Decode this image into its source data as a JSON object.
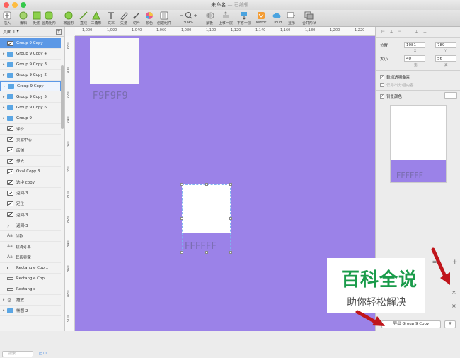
{
  "window": {
    "title": "未命名",
    "subtitle": "— 已编辑"
  },
  "toolbar": [
    {
      "label": "插入",
      "icon": "plus-icon"
    },
    {
      "label": "编辑",
      "icon": "edit-icon"
    },
    {
      "label": "矩形",
      "icon": "rectangle-icon"
    },
    {
      "label": "圆角矩形",
      "icon": "rounded-rect-icon"
    },
    {
      "label": "椭圆形",
      "icon": "oval-icon"
    },
    {
      "label": "直线",
      "icon": "line-icon"
    },
    {
      "label": "三角形",
      "icon": "triangle-icon"
    },
    {
      "label": "文本",
      "icon": "text-icon"
    },
    {
      "label": "矢量",
      "icon": "vector-icon"
    },
    {
      "label": "切片",
      "icon": "slice-icon"
    },
    {
      "label": "颜色",
      "icon": "color-icon"
    },
    {
      "label": "创建组件",
      "icon": "component-icon"
    },
    {
      "label": "309%",
      "icon": "zoom-icon"
    },
    {
      "label": "蒙板",
      "icon": "mask-icon"
    },
    {
      "label": "上移一层",
      "icon": "forward-icon"
    },
    {
      "label": "下移一层",
      "icon": "backward-icon"
    },
    {
      "label": "Mirror",
      "icon": "mirror-icon"
    },
    {
      "label": "Cloud",
      "icon": "cloud-icon"
    },
    {
      "label": "显示",
      "icon": "view-icon"
    },
    {
      "label": "合并形状",
      "icon": "export-icon"
    }
  ],
  "sidebar": {
    "page": "页面 1",
    "search_placeholder": "搜索",
    "layer_count": "10",
    "layers": [
      {
        "name": "Group 9 Copy",
        "type": "symbol",
        "state": "selected"
      },
      {
        "name": "Group 9 Copy 4",
        "type": "folder"
      },
      {
        "name": "Group 9 Copy 3",
        "type": "folder"
      },
      {
        "name": "Group 9 Copy 2",
        "type": "folder"
      },
      {
        "name": "Group 9 Copy",
        "type": "folder",
        "state": "highlight"
      },
      {
        "name": "Group 9 Copy 5",
        "type": "folder"
      },
      {
        "name": "Group 9 Copy 6",
        "type": "folder"
      },
      {
        "name": "Group 9",
        "type": "folder"
      },
      {
        "name": "评价",
        "type": "symbol"
      },
      {
        "name": "卖家中心",
        "type": "symbol"
      },
      {
        "name": "店铺",
        "type": "symbol"
      },
      {
        "name": "想去",
        "type": "symbol"
      },
      {
        "name": "Oval Copy 3",
        "type": "symbol"
      },
      {
        "name": "选中 copy",
        "type": "symbol"
      },
      {
        "name": "返回-3",
        "type": "symbol"
      },
      {
        "name": "定位",
        "type": "symbol"
      },
      {
        "name": "返回-3",
        "type": "symbol"
      },
      {
        "name": "返回-3",
        "type": "chevron"
      },
      {
        "name": "付款",
        "type": "text"
      },
      {
        "name": "取消订单",
        "type": "text"
      },
      {
        "name": "联系卖家",
        "type": "text"
      },
      {
        "name": "Rectangle Cop...",
        "type": "rect"
      },
      {
        "name": "Rectangle Cop...",
        "type": "rect"
      },
      {
        "name": "Rectangle",
        "type": "rect"
      },
      {
        "name": "播放",
        "type": "gear"
      },
      {
        "name": "椭圆-2",
        "type": "folder"
      }
    ]
  },
  "ruler": {
    "h": [
      "1,000",
      "1,020",
      "1,040",
      "1,060",
      "1,080",
      "1,100",
      "1,120",
      "1,140",
      "1,160",
      "1,180",
      "1,200",
      "1,220"
    ],
    "v": [
      "680",
      "700",
      "720",
      "740",
      "760",
      "780",
      "800",
      "820",
      "840",
      "860",
      "880",
      "900"
    ]
  },
  "canvas": {
    "tile1_label": "F9F9F9",
    "tile2_label": "FFFFFF",
    "background": "#9b82e8"
  },
  "inspector": {
    "position_label": "位置",
    "x": "1081",
    "y": "789",
    "x_cap": "X",
    "y_cap": "Y",
    "size_label": "大小",
    "w": "40",
    "h": "56",
    "w_cap": "宽",
    "h_cap": "高",
    "trim_label": "裁切透明像素",
    "export_group_label": "仅导出分组内容",
    "bg_label": "背景颜色",
    "preview_label": "FFFFFF",
    "export_button": "导出 Group 9 Copy"
  },
  "watermark": {
    "line1": "百科全说",
    "line2": "助你轻松解决"
  }
}
